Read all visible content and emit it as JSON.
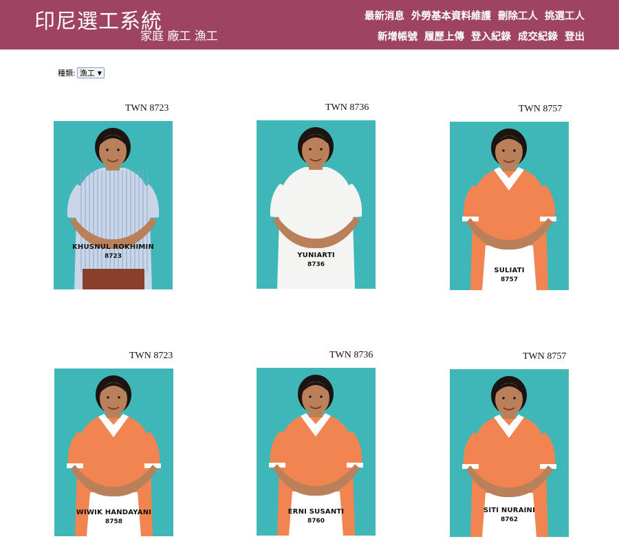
{
  "header": {
    "title": "印尼選工系統",
    "subtitle": "家庭 廠工 漁工",
    "nav_row1": [
      "最新消息",
      "外勞基本資料維護",
      "刪除工人",
      "挑選工人"
    ],
    "nav_row2": [
      "新增帳號",
      "履歷上傳",
      "登入紀錄",
      "成交紀錄",
      "登出"
    ]
  },
  "filter": {
    "label": "種類:",
    "selected": "漁工"
  },
  "workers": [
    {
      "code": "TWN  8723",
      "name": "KHUSNUL ROKHIMIN",
      "number": "8723",
      "outfit": "blue-stripe-shirt"
    },
    {
      "code": "TWN  8736",
      "name": "YUNIARTI",
      "number": "8736",
      "outfit": "white-shirt"
    },
    {
      "code": "TWN  8757",
      "name": "SULIATI",
      "number": "8757",
      "outfit": "orange-uniform"
    },
    {
      "code": "TWN  8723",
      "name": "WIWIK HANDAYANI",
      "number": "8758",
      "outfit": "orange-uniform"
    },
    {
      "code": "TWN  8736",
      "name": "ERNI SUSANTI",
      "number": "8760",
      "outfit": "orange-uniform"
    },
    {
      "code": "TWN  8757",
      "name": "SITI NURAINI",
      "number": "8762",
      "outfit": "orange-uniform"
    }
  ],
  "colors": {
    "header_bg": "#9e4462",
    "photo_bg": "#3fb6b7",
    "uniform_orange": "#f08552",
    "collar_white": "#ffffff"
  }
}
